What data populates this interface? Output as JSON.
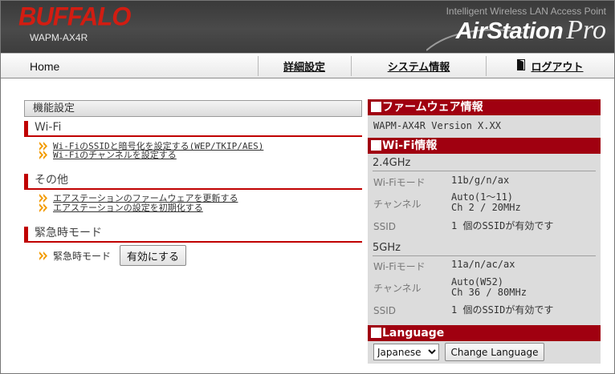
{
  "header": {
    "logo": "BUFFALO",
    "model": "WAPM-AX4R",
    "tagline": "Intelligent Wireless LAN Access Point",
    "brand_main": "AirStation",
    "brand_pro": "Pro"
  },
  "nav": {
    "home": "Home",
    "detail_settings": "詳細設定",
    "system_info": "システム情報",
    "logout": "ログアウト"
  },
  "left": {
    "title": "機能設定",
    "sections": [
      {
        "title": "Wi-Fi",
        "links": [
          "Wi-FiのSSIDと暗号化を設定する(WEP/TKIP/AES)",
          "Wi-Fiのチャンネルを設定する"
        ]
      },
      {
        "title": "その他",
        "links": [
          "エアステーションのファームウェアを更新する",
          "エアステーションの設定を初期化する"
        ]
      },
      {
        "title": "緊急時モード",
        "label": "緊急時モード",
        "button": "有効にする"
      }
    ]
  },
  "right": {
    "firmware": {
      "title": "ファームウェア情報",
      "value": "WAPM-AX4R Version X.XX"
    },
    "wifi": {
      "title": "Wi-Fi情報",
      "bands": [
        {
          "name": "2.4GHz",
          "mode_label": "Wi-Fiモード",
          "mode": "11b/g/n/ax",
          "channel_label": "チャンネル",
          "channel_line1": "Auto(1～11)",
          "channel_line2": "Ch 2 / 20MHz",
          "ssid_label": "SSID",
          "ssid": "1 個のSSIDが有効です"
        },
        {
          "name": "5GHz",
          "mode_label": "Wi-Fiモード",
          "mode": "11a/n/ac/ax",
          "channel_label": "チャンネル",
          "channel_line1": "Auto(W52)",
          "channel_line2": "Ch 36 / 80MHz",
          "ssid_label": "SSID",
          "ssid": "1 個のSSIDが有効です"
        }
      ]
    },
    "language": {
      "title": "Language",
      "selected": "Japanese",
      "button": "Change Language"
    }
  },
  "colors": {
    "accent_red": "#a00010",
    "logo_red": "#d21d12",
    "header_bg": "#3a3a3a",
    "panel_bg": "#dcdcdc"
  }
}
